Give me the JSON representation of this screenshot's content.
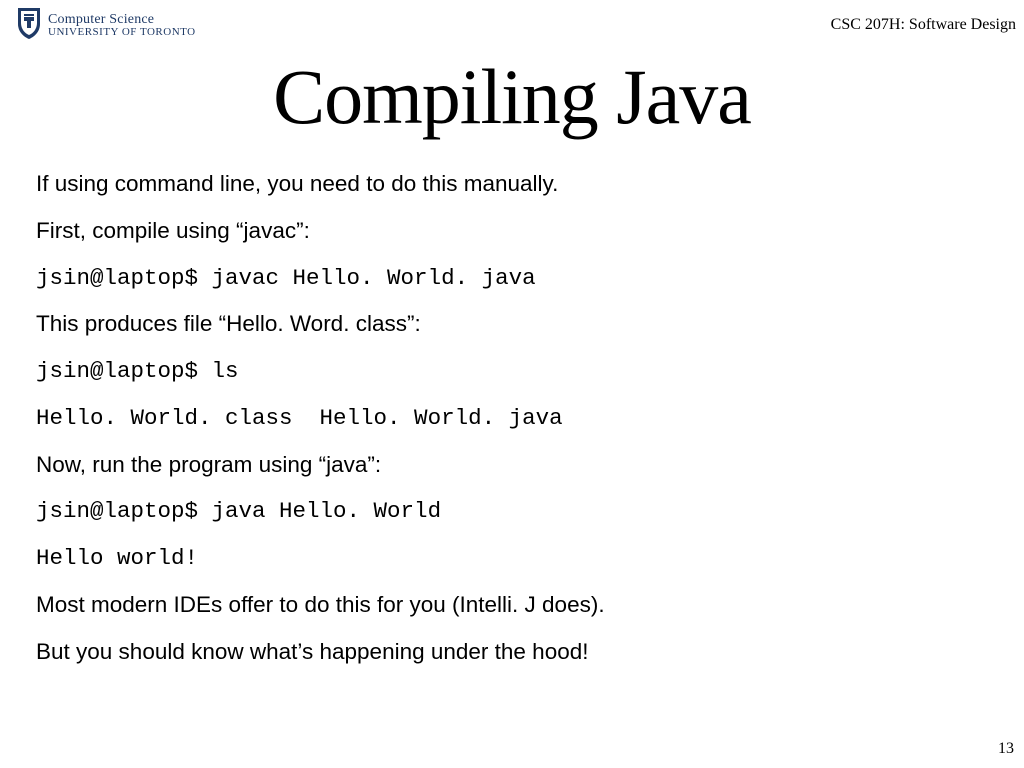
{
  "header": {
    "logo_line1": "Computer Science",
    "logo_line2": "University of Toronto",
    "course": "CSC 207H: Software Design"
  },
  "title": "Compiling Java",
  "content": {
    "p1": "If using command line, you need to do this manually.",
    "p2": "First, compile using “javac”:",
    "cmd1": "jsin@laptop$ javac Hello. World. java",
    "p3": "This produces file “Hello. Word. class”:",
    "cmd2": "jsin@laptop$ ls",
    "cmd3": "Hello. World. class  Hello. World. java",
    "p4": "Now, run the program using “java”:",
    "cmd4": "jsin@laptop$ java Hello. World",
    "cmd5": "Hello world!",
    "p5": "Most modern IDEs offer to do this for you (Intelli. J does).",
    "p6": "But you should know what’s happening under the hood!"
  },
  "page_number": "13"
}
